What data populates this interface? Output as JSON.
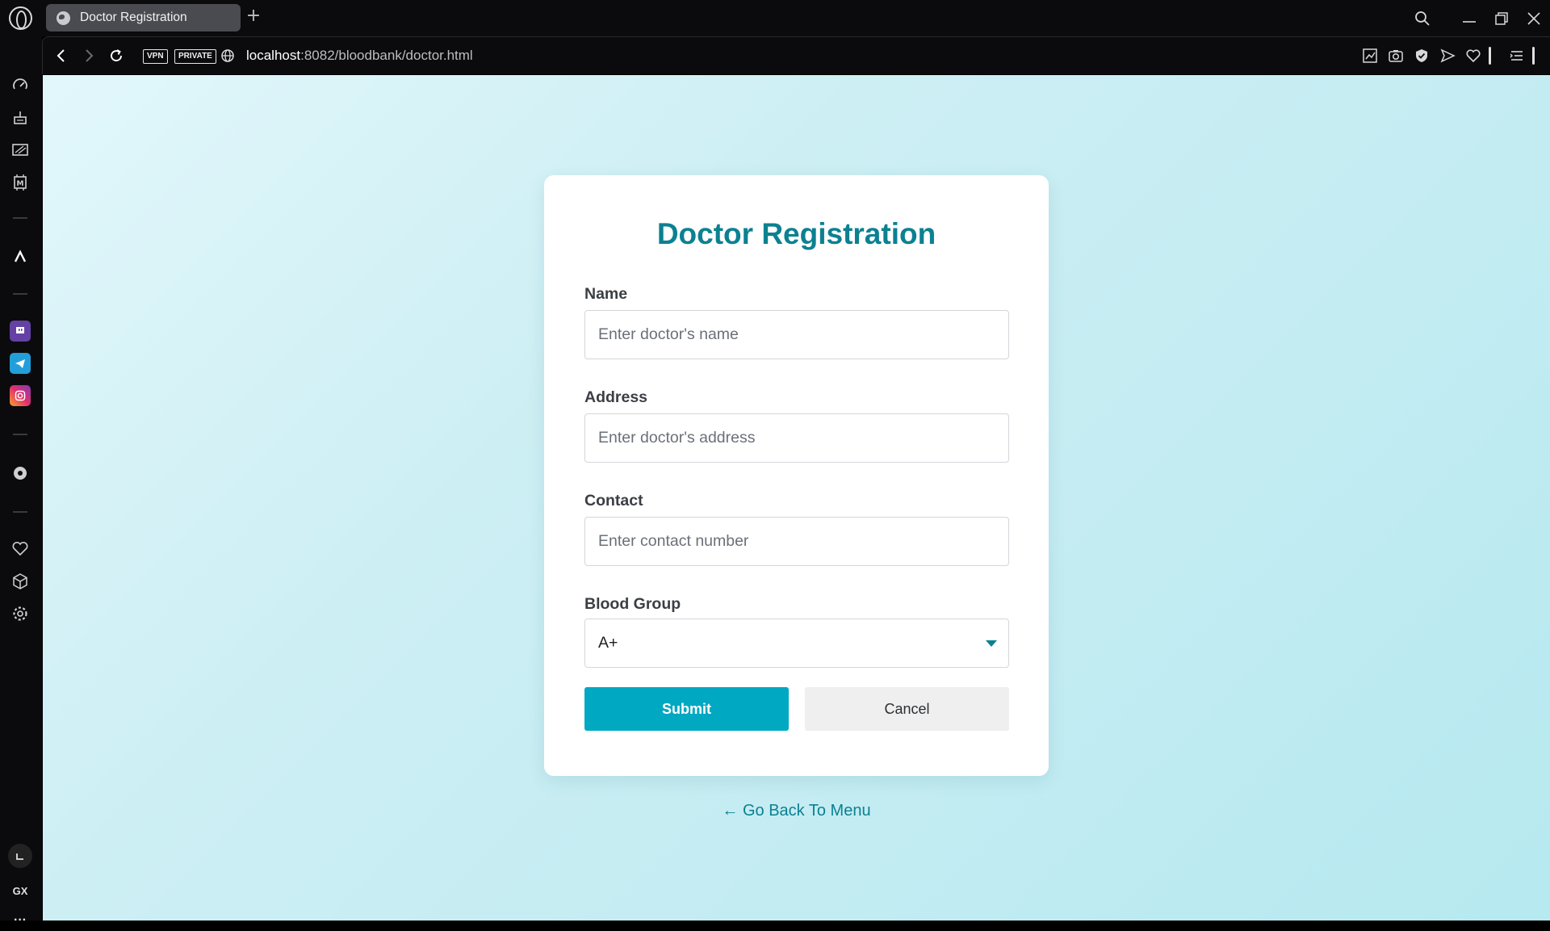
{
  "browser": {
    "tab_title": "Doctor Registration",
    "new_tab_symbol": "+",
    "vpn_badge": "VPN",
    "private_badge": "PRIVATE",
    "url_host": "localhost",
    "url_rest": ":8082/bloodbank/doctor.html",
    "sidebar_gx_label": "GX",
    "sidebar_more": "···"
  },
  "form": {
    "title": "Doctor Registration",
    "name_label": "Name",
    "name_placeholder": "Enter doctor's name",
    "address_label": "Address",
    "address_placeholder": "Enter doctor's address",
    "contact_label": "Contact",
    "contact_placeholder": "Enter contact number",
    "blood_group_label": "Blood Group",
    "blood_group_selected": "A+",
    "submit_label": "Submit",
    "cancel_label": "Cancel"
  },
  "back_link": "← Go Back To Menu",
  "colors": {
    "accent": "#0b8191",
    "submit_bg": "#00a8c2",
    "cancel_bg": "#efefef",
    "page_bg": "#c8eef4",
    "browser_chrome": "#0b0b0d"
  }
}
